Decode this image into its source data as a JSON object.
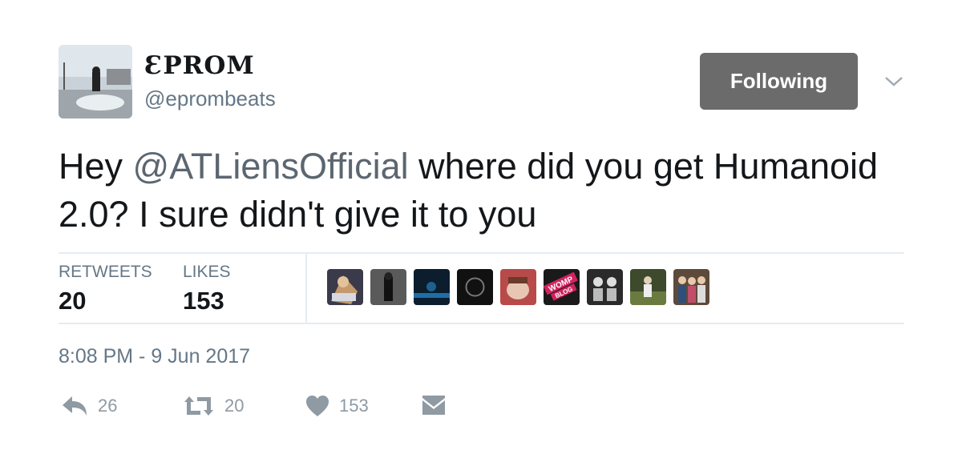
{
  "profile": {
    "display_name": "ƐPROM",
    "handle": "@eprombeats",
    "avatar_icon": "profile-photo"
  },
  "follow_button": {
    "label": "Following"
  },
  "menu": {
    "icon": "chevron-down-icon"
  },
  "tweet": {
    "text_prefix": "Hey ",
    "mention": "@ATLiensOfficial",
    "text_suffix": " where did you get Humanoid 2.0? I sure didn't give it to you"
  },
  "stats": {
    "retweets_label": "RETWEETS",
    "retweets_value": "20",
    "likes_label": "LIKES",
    "likes_value": "153"
  },
  "likers": [
    {
      "icon": "avatar-1"
    },
    {
      "icon": "avatar-2"
    },
    {
      "icon": "avatar-3"
    },
    {
      "icon": "avatar-4"
    },
    {
      "icon": "avatar-5"
    },
    {
      "icon": "avatar-6",
      "text": "WOMP BLOG"
    },
    {
      "icon": "avatar-7"
    },
    {
      "icon": "avatar-8"
    },
    {
      "icon": "avatar-9"
    }
  ],
  "timestamp": "8:08 PM - 9 Jun 2017",
  "actions": {
    "reply": {
      "icon": "reply-icon",
      "count": "26"
    },
    "retweet": {
      "icon": "retweet-icon",
      "count": "20"
    },
    "like": {
      "icon": "heart-icon",
      "count": "153"
    },
    "message": {
      "icon": "message-icon"
    }
  },
  "colors": {
    "text": "#14171a",
    "secondary": "#657786",
    "button_bg": "#6b6b6b",
    "action_gray": "#8f9aa3",
    "divider": "#e6ecf0"
  }
}
